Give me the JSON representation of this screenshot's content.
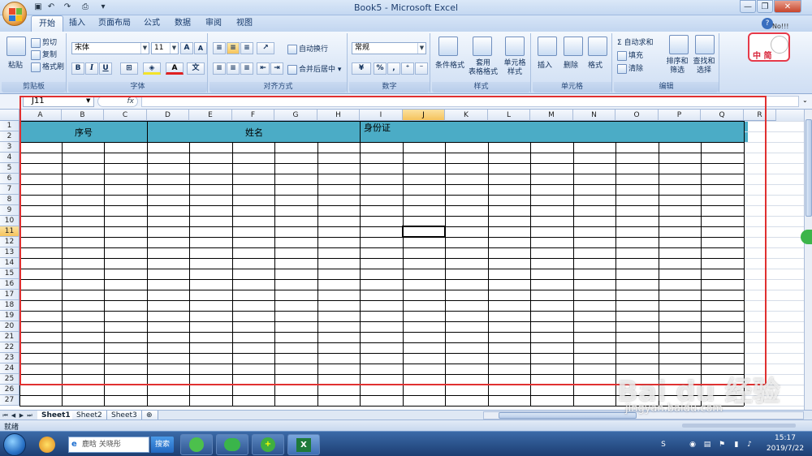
{
  "window": {
    "title": "Book5 - Microsoft Excel"
  },
  "tabs": [
    "开始",
    "插入",
    "页面布局",
    "公式",
    "数据",
    "审阅",
    "视图"
  ],
  "ribbon": {
    "clipboard": {
      "paste": "粘贴",
      "cut": "剪切",
      "copy": "复制",
      "format_painter": "格式刷",
      "label": "剪贴板"
    },
    "font": {
      "name": "宋体",
      "size": "11",
      "bold": "B",
      "italic": "I",
      "underline": "U",
      "grow": "A",
      "shrink": "A",
      "label": "字体"
    },
    "alignment": {
      "wrap": "自动换行",
      "merge": "合并后居中",
      "label": "对齐方式"
    },
    "number": {
      "format": "常规",
      "percent": "%",
      "comma": ",",
      "label": "数字"
    },
    "styles": {
      "conditional": "条件格式",
      "table": "套用\n表格格式",
      "cell_styles": "单元格\n样式",
      "label": "样式"
    },
    "cells": {
      "insert": "插入",
      "delete": "删除",
      "format": "格式",
      "label": "单元格"
    },
    "editing": {
      "autosum": "Σ 自动求和",
      "fill": "填充",
      "clear": "清除",
      "sort": "排序和\n筛选",
      "find": "查找和\n选择",
      "label": "编辑"
    }
  },
  "ime": {
    "text": "中 简",
    "top": "No!!!"
  },
  "formula_bar": {
    "name_box": "J11",
    "fx": "fx",
    "value": ""
  },
  "columns": [
    "A",
    "B",
    "C",
    "D",
    "E",
    "F",
    "G",
    "H",
    "I",
    "J",
    "K",
    "L",
    "M",
    "N",
    "O",
    "P",
    "Q",
    "R"
  ],
  "active_column": "J",
  "rows": [
    "1",
    "2",
    "3",
    "4",
    "5",
    "6",
    "7",
    "8",
    "9",
    "10",
    "11",
    "12",
    "13",
    "14",
    "15",
    "16",
    "17",
    "18",
    "19",
    "20",
    "21",
    "22",
    "23",
    "24",
    "25",
    "26",
    "27"
  ],
  "active_row": "11",
  "table_headers": {
    "seq": "序号",
    "name": "姓名",
    "id_card": "身份证"
  },
  "sheets": [
    "Sheet1",
    "Sheet2",
    "Sheet3"
  ],
  "active_sheet": "Sheet1",
  "status": {
    "ready": "就绪"
  },
  "taskbar": {
    "search_text": "鹿晗 关晓彤",
    "search_btn": "搜索",
    "time": "15:17",
    "date": "2019/7/22"
  },
  "watermark": {
    "main": "Bai du 经验",
    "sub": "jingyan.baidu.com"
  },
  "colors": {
    "header_fill": "#4bacc6",
    "annotation": "#e03030",
    "active_header": "#f5c35c"
  }
}
